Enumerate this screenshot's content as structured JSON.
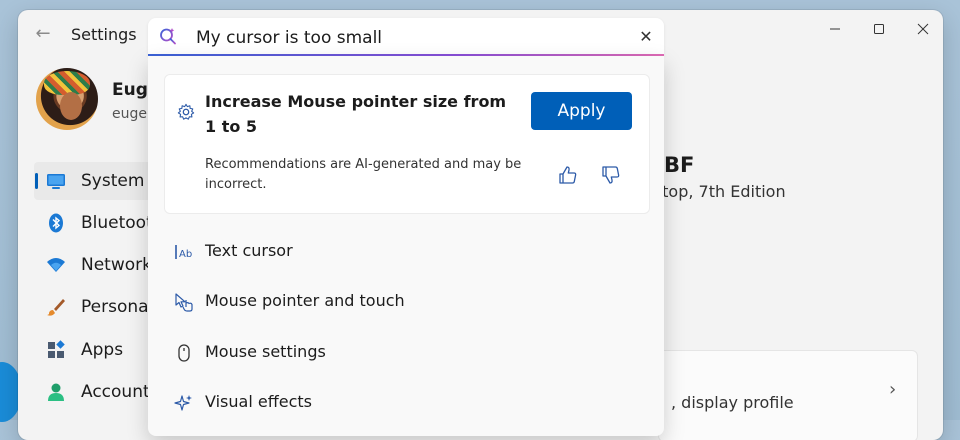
{
  "window": {
    "title": "Settings"
  },
  "profile": {
    "name": "Euge",
    "email": "euge"
  },
  "sidebar": {
    "items": [
      {
        "label": "System",
        "icon": "monitor-icon",
        "active": true
      },
      {
        "label": "Bluetoot",
        "icon": "bluetooth-icon",
        "active": false
      },
      {
        "label": "Network",
        "icon": "wifi-icon",
        "active": false
      },
      {
        "label": "Personal",
        "icon": "brush-icon",
        "active": false
      },
      {
        "label": "Apps",
        "icon": "apps-icon",
        "active": false
      },
      {
        "label": "Account",
        "icon": "person-icon",
        "active": false
      }
    ]
  },
  "main": {
    "device_name": "BF",
    "device_sub": "ptop, 7th Edition",
    "card_text": ", display profile"
  },
  "search": {
    "value": "My cursor is too small"
  },
  "suggestion": {
    "title": "Increase Mouse pointer size from 1 to 5",
    "apply_label": "Apply",
    "disclaimer": "Recommendations are AI-generated and may be incorrect."
  },
  "results": [
    {
      "label": "Text cursor",
      "icon": "text-cursor-icon"
    },
    {
      "label": "Mouse pointer and touch",
      "icon": "pointer-touch-icon"
    },
    {
      "label": "Mouse settings",
      "icon": "mouse-icon"
    },
    {
      "label": "Visual effects",
      "icon": "sparkle-icon"
    }
  ],
  "colors": {
    "accent": "#005fb8",
    "search_gradient_start": "#3b63d8",
    "search_gradient_end": "#e06bb5"
  }
}
